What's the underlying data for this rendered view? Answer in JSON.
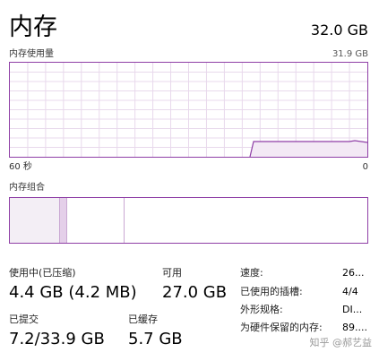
{
  "header": {
    "title": "内存",
    "total": "32.0 GB"
  },
  "usage_graph": {
    "label": "内存使用量",
    "max_label": "31.9 GB",
    "time_left": "60 秒",
    "time_right": "0",
    "line_color": "#8f3fa6",
    "fill_color": "#f3e9f5",
    "grid_color": "#e8d9ec"
  },
  "composition": {
    "label": "内存组合",
    "segments": [
      {
        "name": "in-use",
        "fraction": 0.14,
        "color": "#f3eef5"
      },
      {
        "name": "modified",
        "fraction": 0.02,
        "color": "#e4cfe9"
      },
      {
        "name": "standby",
        "fraction": 0.16,
        "color": "#ffffff"
      },
      {
        "name": "free",
        "fraction": 0.68,
        "color": "#ffffff"
      }
    ]
  },
  "stats": {
    "in_use_label": "使用中(已压缩)",
    "in_use_value": "4.4 GB (4.2 MB)",
    "available_label": "可用",
    "available_value": "27.0 GB",
    "committed_label": "已提交",
    "committed_value": "7.2/33.9 GB",
    "cached_label": "已缓存",
    "cached_value": "5.7 GB"
  },
  "details": [
    {
      "key": "速度:",
      "value": "26..."
    },
    {
      "key": "已使用的插槽:",
      "value": "4/4"
    },
    {
      "key": "外形规格:",
      "value": "DI..."
    },
    {
      "key": "为硬件保留的内存:",
      "value": "89...."
    }
  ],
  "watermark": "知乎 @郝艺益"
}
